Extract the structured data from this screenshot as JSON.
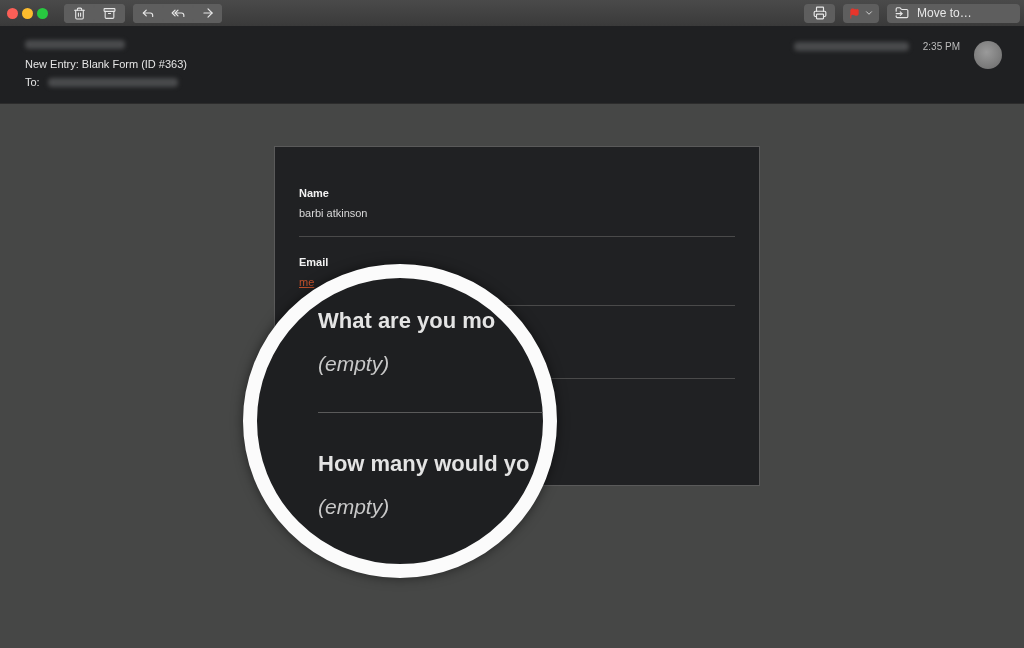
{
  "toolbar": {
    "move_button": {
      "label": "Move to…"
    }
  },
  "header": {
    "subject": "New Entry: Blank Form (ID #363)",
    "to_label": "To:",
    "time": "2:35 PM"
  },
  "form": {
    "fields": [
      {
        "label": "Name",
        "value": "barbi atkinson",
        "kind": "text"
      },
      {
        "label": "Email",
        "value": "me",
        "kind": "link"
      }
    ]
  },
  "magnifier": {
    "items": [
      {
        "label": "What are you mo",
        "value": "(empty)"
      },
      {
        "label": "How many would yo",
        "value": "(empty)"
      }
    ]
  }
}
